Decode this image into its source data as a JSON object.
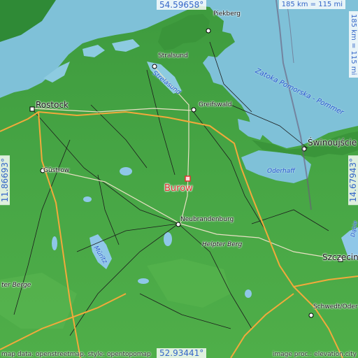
{
  "coordinates": {
    "top": "54.59658°",
    "bottom": "52.93441°",
    "left": "11.86693°",
    "right": "14.67943°"
  },
  "scale": {
    "horizontal": "185 km = 115 mi",
    "vertical": "185 km = 115 mi"
  },
  "target": {
    "name": "Burow"
  },
  "cities": {
    "rostock": "Rostock",
    "stralsund": "Stralsund",
    "greifswald": "Greifswald",
    "piekberg": "Piekberg",
    "swinoujscie": "Świnoujście",
    "gustrow": "Güstrow",
    "neubrandenburg": "Neubrandenburg",
    "helpter_berg": "Helpter Berg",
    "szczecin": "Szczecin",
    "schwedt": "Schwedt/Oder",
    "ter_berge": "ter Berge"
  },
  "water": {
    "strelasund": "Strelasund",
    "zatoka": "Zatoka Pomorska - Pommer",
    "oderhaff": "Oderhaff",
    "muritz": "Müritz",
    "dabie": "Dąbie"
  },
  "attribution": {
    "left": "map data: openstreetmap, style: opentopomap",
    "right": "image proc.: elevation.city"
  },
  "colors": {
    "sea": "#7fc1d8",
    "land": "#3f9c3f",
    "target": "#e03030",
    "coord_text": "#3466c8",
    "motorway": "#f2a93b"
  }
}
